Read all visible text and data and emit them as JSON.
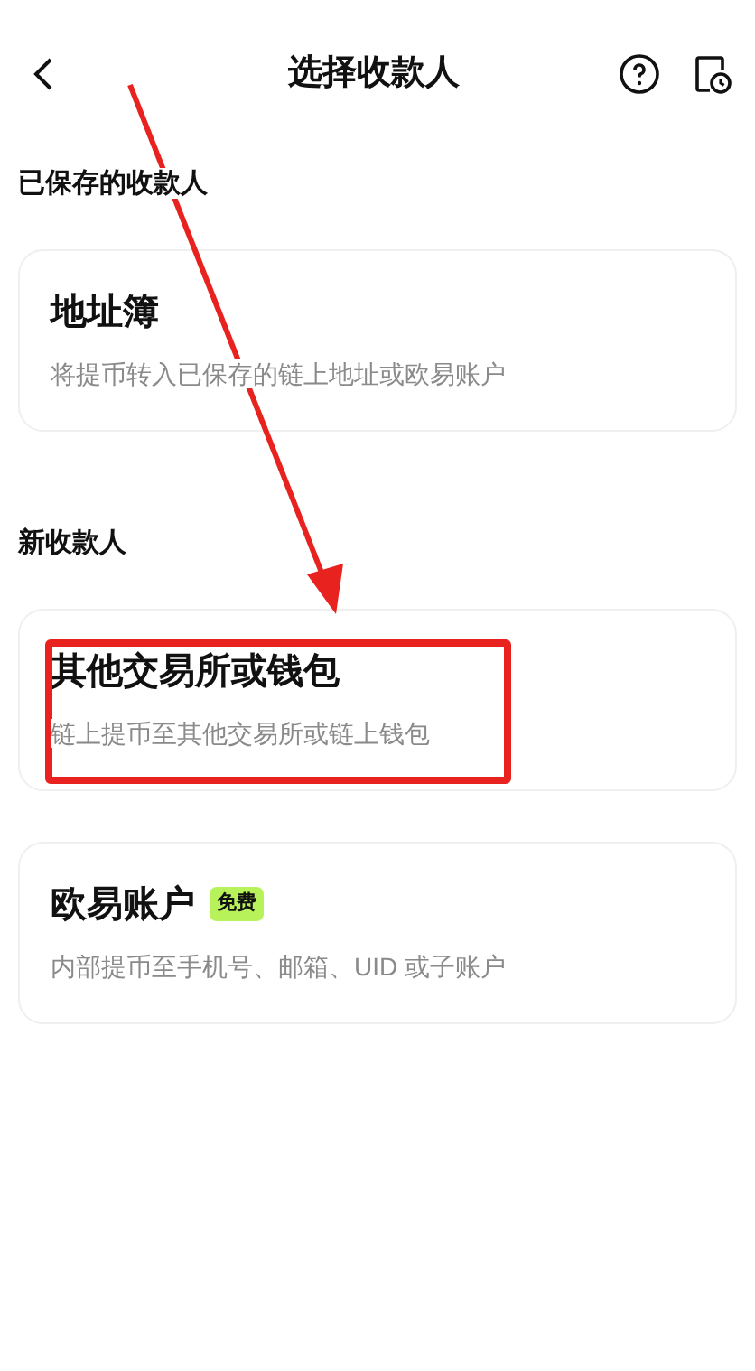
{
  "header": {
    "title": "选择收款人"
  },
  "sections": [
    {
      "label": "已保存的收款人",
      "options": [
        {
          "title": "地址簿",
          "description": "将提币转入已保存的链上地址或欧易账户",
          "highlighted": false
        }
      ]
    },
    {
      "label": "新收款人",
      "options": [
        {
          "title": "其他交易所或钱包",
          "description": "链上提币至其他交易所或链上钱包",
          "highlighted": true
        },
        {
          "title": "欧易账户",
          "badge": "免费",
          "description": "内部提币至手机号、邮箱、UID 或子账户",
          "highlighted": false
        }
      ]
    }
  ]
}
